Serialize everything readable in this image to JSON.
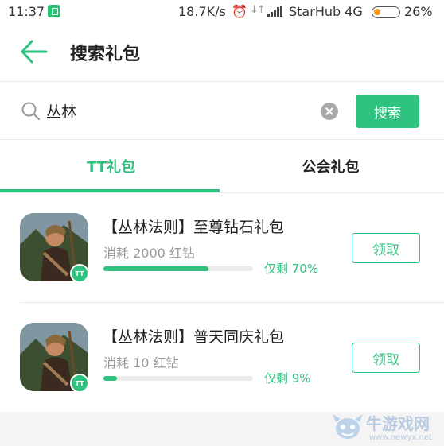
{
  "status_bar": {
    "time": "11:37",
    "speed": "18.7K/s",
    "carrier": "StarHub 4G",
    "battery": "26%",
    "battery_level": 0.26,
    "icons": [
      "app-icon",
      "alarm-icon",
      "data-arrows-icon",
      "signal-icon",
      "battery-icon"
    ]
  },
  "header": {
    "title": "搜索礼包",
    "back_icon": "arrow-left-icon"
  },
  "search": {
    "value": "丛林",
    "search_button": "搜索",
    "icons": [
      "search-icon",
      "clear-icon"
    ]
  },
  "tabs": [
    {
      "label": "TT礼包",
      "active": true
    },
    {
      "label": "公会礼包",
      "active": false
    }
  ],
  "gifts": [
    {
      "title": "【丛林法则】至尊钻石礼包",
      "cost": "消耗 2000 红钻",
      "remaining": "仅剩 70%",
      "remaining_level": 0.7,
      "button": "领取"
    },
    {
      "title": "【丛林法则】普天同庆礼包",
      "cost": "消耗 10 红钻",
      "remaining": "仅剩 9%",
      "remaining_level": 0.09,
      "button": "领取"
    }
  ],
  "watermark": {
    "text": "牛游戏网",
    "url": "www.newyx.net"
  },
  "colors": {
    "accent": "#2ec27e",
    "battery": "#f29a1f",
    "muted_text": "#999999"
  }
}
